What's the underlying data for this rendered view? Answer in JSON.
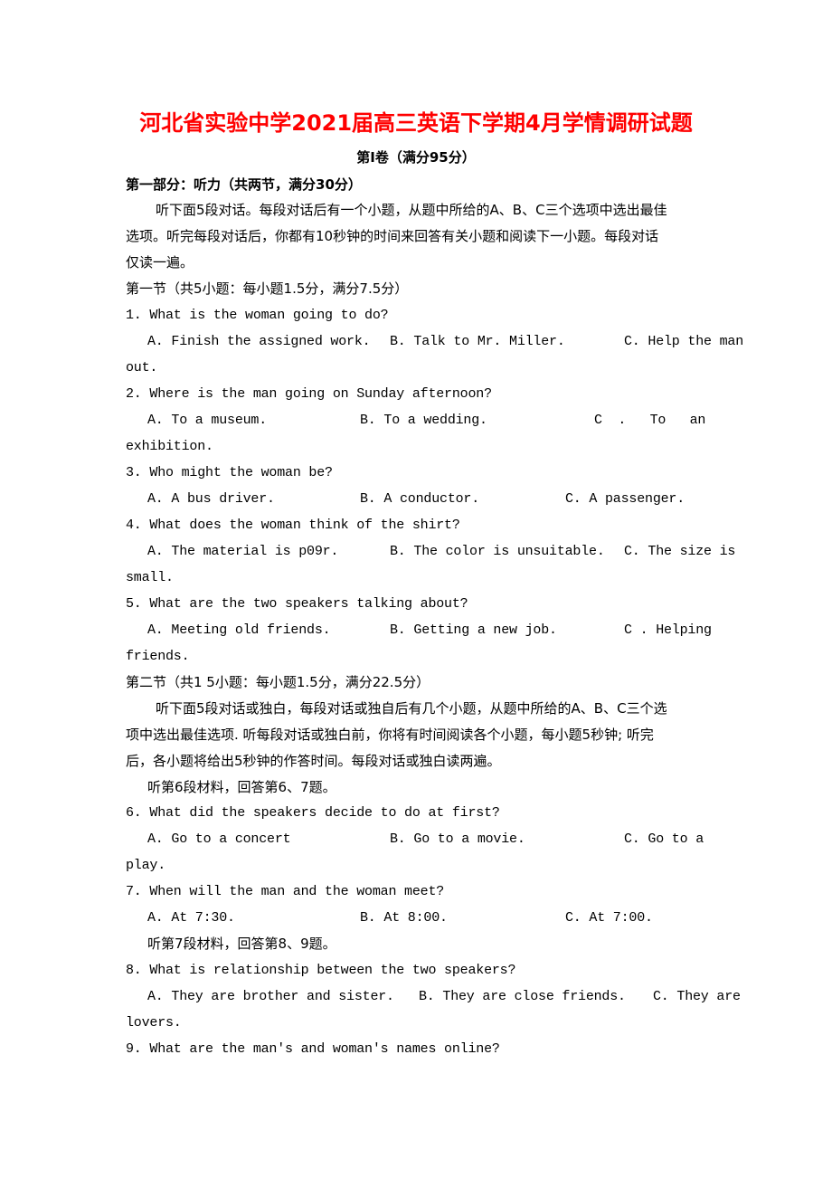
{
  "document": {
    "title": "河北省实验中学2021届高三英语下学期4月学情调研试题",
    "subtitle": "第Ⅰ卷（满分95分）",
    "part1_heading": "第一部分：听力（共两节，满分30分）",
    "section1": {
      "intro_lines": [
        "听下面5段对话。每段对话后有一个小题，从题中所给的A、B、C三个选项中选出最佳",
        "选项。听完每段对话后，你都有10秒钟的时间来回答有关小题和阅读下一小题。每段对话",
        "仅读一遍。"
      ],
      "heading": "第一节（共5小题：每小题1.5分，满分7.5分）",
      "questions": [
        {
          "stem": "1. What is the woman going to do?",
          "options": [
            "A. Finish the assigned work.",
            "B. Talk to Mr. Miller.",
            "C. Help the man"
          ],
          "wrap": "out."
        },
        {
          "stem": "2. Where is the man going on Sunday afternoon?",
          "options": [
            "A. To a museum.",
            "B. To a wedding.",
            "C  .   To   an"
          ],
          "wrap": "exhibition."
        },
        {
          "stem": "3. Who might the woman be?",
          "options": [
            "A. A bus driver.",
            "B. A conductor.",
            "C. A passenger."
          ],
          "wrap": ""
        },
        {
          "stem": "4. What does the woman think of the shirt?",
          "options": [
            "A. The material is p09r.",
            "B. The color is unsuitable.",
            "C. The size is"
          ],
          "wrap": "small."
        },
        {
          "stem": "5. What are the two speakers talking about?",
          "options": [
            "A. Meeting old friends.",
            "B. Getting a new job.",
            "C . Helping"
          ],
          "wrap": "friends."
        }
      ]
    },
    "section2": {
      "heading": "第二节（共1 5小题：每小题1.5分，满分22.5分）",
      "intro_lines": [
        "听下面5段对话或独白，每段对话或独自后有几个小题，从题中所给的A、B、C三个选",
        "项中选出最佳选项. 听每段对话或独白前，你将有时间阅读各个小题，每小题5秒钟; 听完",
        "后，各小题将给出5秒钟的作答时间。每段对话或独白读两遍。"
      ],
      "material6": "听第6段材料，回答第6、7题。",
      "material7": "听第7段材料，回答第8、9题。",
      "questions": [
        {
          "stem": "6. What did the speakers decide to do at first?",
          "options": [
            "A. Go to a concert",
            "B. Go to a movie.",
            "C. Go to a"
          ],
          "wrap": "play."
        },
        {
          "stem": "7. When will the man and the woman meet?",
          "options": [
            "A. At 7:30.",
            "B. At 8:00.",
            "C. At 7:00."
          ],
          "wrap": ""
        },
        {
          "stem": "8. What is relationship between the two speakers?",
          "options": [
            "A. They are brother and sister.",
            "B. They are close friends.",
            "C. They are"
          ],
          "wrap": "lovers."
        },
        {
          "stem": "9. What are the man's and woman's names online?",
          "options": [],
          "wrap": ""
        }
      ]
    }
  }
}
